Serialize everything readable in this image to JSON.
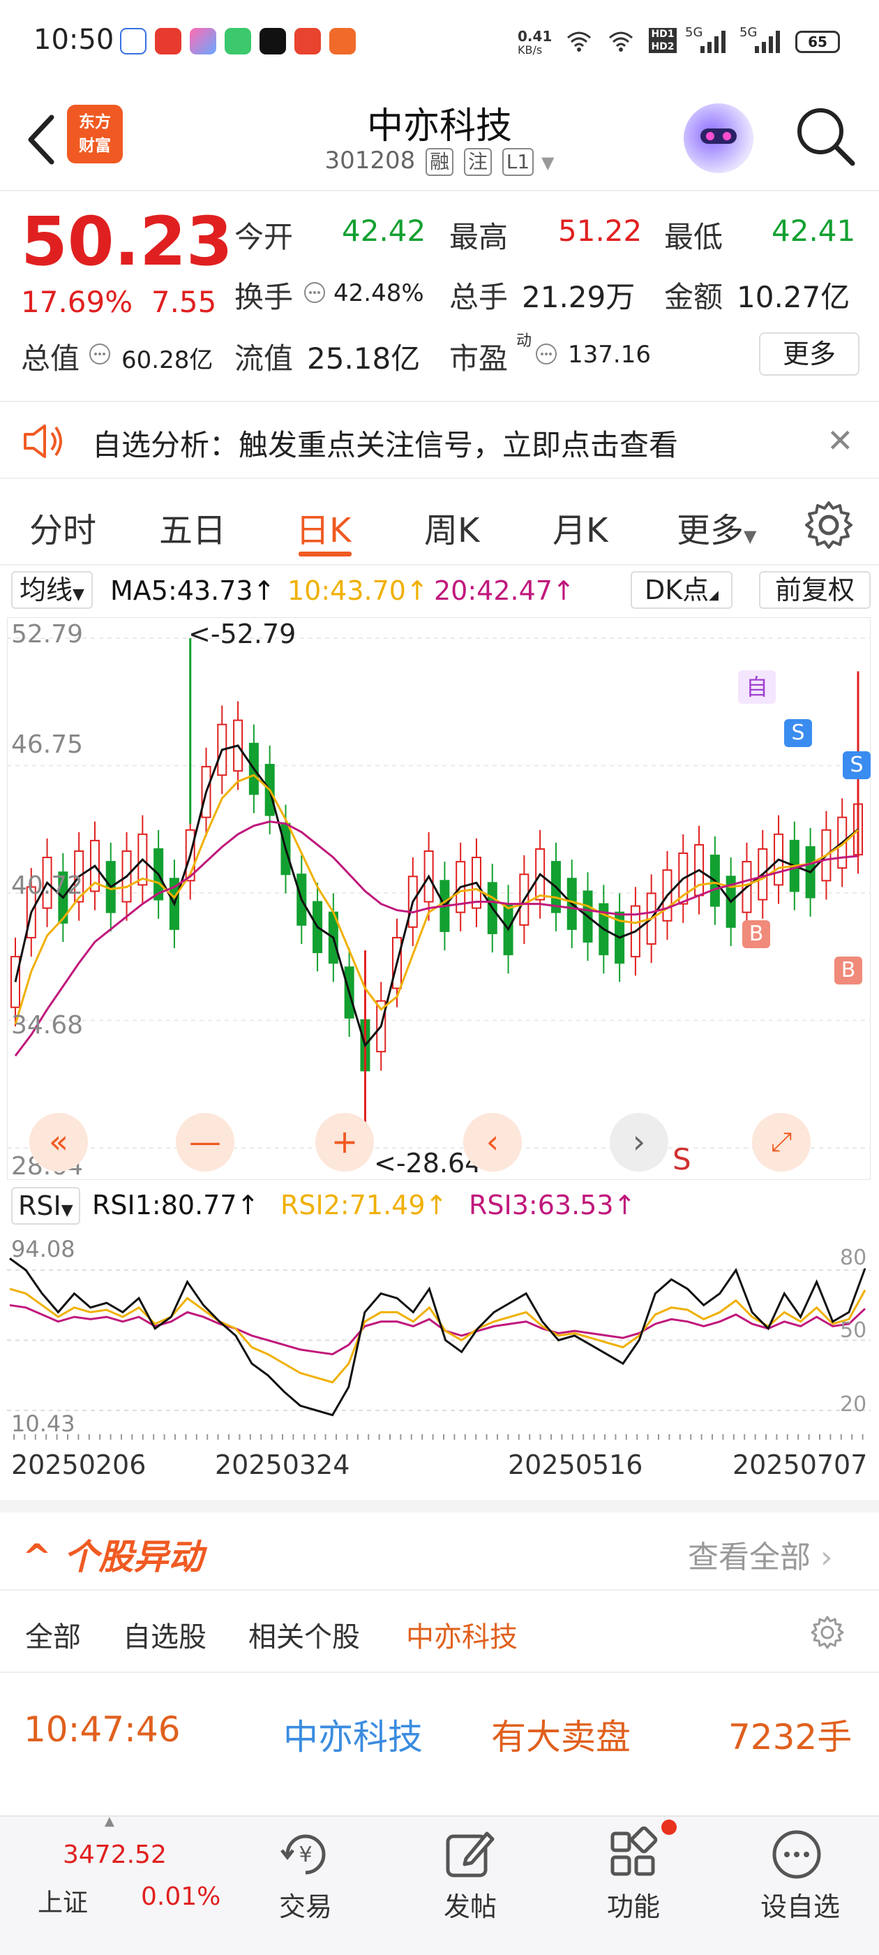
{
  "status": {
    "time": "10:50",
    "net_speed_top": "0.41",
    "net_speed_unit": "KB/s",
    "hd1": "HD1",
    "hd2": "HD2",
    "sig1": "5G",
    "sig2": "5G",
    "battery": "65"
  },
  "header": {
    "logo": "东方财富",
    "title": "中亦科技",
    "code": "301208",
    "tags": [
      "融",
      "注",
      "L1"
    ]
  },
  "quote": {
    "price": "50.23",
    "change_pct": "17.69%",
    "change_amt": "7.55",
    "fields": [
      {
        "label": "今开",
        "value": "42.42",
        "color": "#12a030"
      },
      {
        "label": "最高",
        "value": "51.22",
        "color": "#e02020"
      },
      {
        "label": "最低",
        "value": "42.41",
        "color": "#12a030"
      },
      {
        "label": "换手",
        "value": "42.48%"
      },
      {
        "label": "总手",
        "value": "21.29万"
      },
      {
        "label": "金额",
        "value": "10.27亿"
      },
      {
        "label": "总值",
        "value": "60.28亿"
      },
      {
        "label": "流值",
        "value": "25.18亿"
      },
      {
        "label": "市盈",
        "sup": "动",
        "value": "137.16"
      }
    ],
    "more": "更多"
  },
  "notice": {
    "text": "自选分析：触发重点关注信号，立即点击查看"
  },
  "tabs": [
    "分时",
    "五日",
    "日K",
    "周K",
    "月K",
    "更多"
  ],
  "active_tab": 2,
  "ma_legend": {
    "button": "均线",
    "ma5": "MA5:43.73",
    "ma10": "10:43.70",
    "ma20": "20:42.47",
    "arrow": "↑",
    "dk": "DK点",
    "fq": "前复权"
  },
  "kchart": {
    "y_ticks": [
      "52.79",
      "46.75",
      "40.72",
      "34.68",
      "28.64"
    ],
    "high_label": "<-52.79",
    "low_label": "<-28.64",
    "markers": {
      "zi": "自",
      "s": "S",
      "b": "B"
    },
    "colors": {
      "up": "#e02020",
      "down": "#12a030",
      "ma5": "#111111",
      "ma10": "#f0b000",
      "ma20": "#c0187c"
    }
  },
  "rsi": {
    "button": "RSI",
    "rsi1": "RSI1:80.77",
    "rsi2": "RSI2:71.49",
    "rsi3": "RSI3:63.53",
    "arrow": "↑",
    "top": "94.08",
    "bottom": "10.43",
    "levels": [
      "80",
      "50",
      "20"
    ]
  },
  "dates": [
    "20250206",
    "20250324",
    "20250516",
    "20250707"
  ],
  "movement": {
    "title": "个股异动",
    "view_all": "查看全部",
    "sub_tabs": [
      "全部",
      "自选股",
      "相关个股",
      "中亦科技"
    ],
    "event": {
      "time": "10:47:46",
      "name": "中亦科技",
      "desc": "有大卖盘",
      "volume": "7232手"
    }
  },
  "bottom_nav": {
    "index_value": "3472.52",
    "index_name": "上证",
    "index_change": "0.01%",
    "items": [
      "交易",
      "发帖",
      "功能",
      "设自选"
    ]
  },
  "chart_data": [
    {
      "type": "candlestick",
      "title": "",
      "ylim": [
        28.64,
        52.79
      ],
      "x_tick_labels": [
        "20250206",
        "20250324",
        "20250516",
        "20250707"
      ],
      "annotations": [
        "<-52.79",
        "<-28.64"
      ],
      "series": [
        {
          "name": "MA5",
          "values": [
            36.5,
            39.8,
            41.2,
            40.5,
            41.5,
            42.0,
            41.0,
            41.5,
            42.3,
            41.6,
            40.2,
            42.5,
            45.5,
            47.5,
            47.7,
            46.6,
            45.6,
            42.8,
            40.4,
            39.1,
            38.6,
            36.0,
            33.5,
            34.4,
            37.4,
            40.3,
            41.5,
            40.1,
            41.0,
            41.2,
            40.0,
            39.0,
            40.4,
            41.6,
            41.0,
            40.2,
            39.6,
            39.0,
            38.6,
            38.9,
            39.5,
            40.6,
            41.4,
            41.8,
            41.3,
            40.3,
            41.0,
            41.6,
            42.3,
            42.0,
            41.7,
            42.5,
            43.1,
            43.73
          ]
        },
        {
          "name": "10",
          "values": [
            34.5,
            37.0,
            38.7,
            39.5,
            40.5,
            41.2,
            40.9,
            41.0,
            41.4,
            41.2,
            40.5,
            41.6,
            43.5,
            45.2,
            46.0,
            46.3,
            45.6,
            44.2,
            42.6,
            41.0,
            39.8,
            38.0,
            36.2,
            35.2,
            35.8,
            37.8,
            39.8,
            40.3,
            40.8,
            40.9,
            40.5,
            40.0,
            40.2,
            40.6,
            40.5,
            40.3,
            40.1,
            39.7,
            39.4,
            39.3,
            39.5,
            40.0,
            40.6,
            41.1,
            41.2,
            41.0,
            41.1,
            41.4,
            41.9,
            42.0,
            42.1,
            42.5,
            43.0,
            43.7
          ]
        },
        {
          "name": "20",
          "values": [
            33.0,
            34.0,
            35.2,
            36.3,
            37.4,
            38.4,
            39.0,
            39.6,
            40.2,
            40.7,
            41.0,
            41.5,
            42.2,
            42.9,
            43.5,
            43.9,
            44.1,
            44.0,
            43.6,
            43.0,
            42.4,
            41.6,
            40.8,
            40.2,
            39.9,
            39.8,
            40.0,
            40.1,
            40.2,
            40.3,
            40.3,
            40.2,
            40.2,
            40.2,
            40.1,
            40.0,
            39.9,
            39.8,
            39.7,
            39.7,
            39.8,
            40.0,
            40.3,
            40.6,
            40.9,
            41.1,
            41.3,
            41.5,
            41.7,
            41.9,
            42.1,
            42.3,
            42.4,
            42.47
          ]
        }
      ]
    },
    {
      "type": "line",
      "title": "",
      "ylim": [
        10.43,
        94.08
      ],
      "series": [
        {
          "name": "RSI1",
          "values": [
            85,
            80,
            70,
            62,
            70,
            64,
            66,
            62,
            68,
            55,
            60,
            75,
            65,
            58,
            52,
            40,
            35,
            28,
            22,
            20,
            18,
            30,
            62,
            70,
            68,
            62,
            72,
            50,
            45,
            55,
            62,
            66,
            70,
            58,
            50,
            52,
            48,
            44,
            40,
            50,
            70,
            76,
            72,
            65,
            70,
            80,
            62,
            55,
            70,
            60,
            75,
            58,
            62,
            80.77
          ]
        },
        {
          "name": "RSI2",
          "values": [
            72,
            70,
            65,
            60,
            64,
            62,
            63,
            60,
            64,
            57,
            60,
            68,
            63,
            58,
            55,
            47,
            44,
            40,
            36,
            34,
            32,
            40,
            58,
            62,
            62,
            58,
            64,
            54,
            50,
            55,
            58,
            60,
            62,
            56,
            52,
            53,
            51,
            49,
            47,
            52,
            61,
            64,
            63,
            59,
            62,
            67,
            60,
            56,
            62,
            58,
            64,
            57,
            59,
            71.49
          ]
        },
        {
          "name": "RSI3",
          "values": [
            65,
            64,
            61,
            58,
            60,
            59,
            60,
            58,
            60,
            56,
            58,
            62,
            60,
            57,
            55,
            52,
            50,
            48,
            46,
            45,
            44,
            48,
            56,
            58,
            58,
            56,
            59,
            54,
            52,
            54,
            56,
            57,
            58,
            55,
            53,
            54,
            53,
            52,
            51,
            53,
            57,
            59,
            58,
            56,
            58,
            61,
            57,
            55,
            58,
            56,
            60,
            56,
            57,
            63.53
          ]
        }
      ]
    }
  ]
}
